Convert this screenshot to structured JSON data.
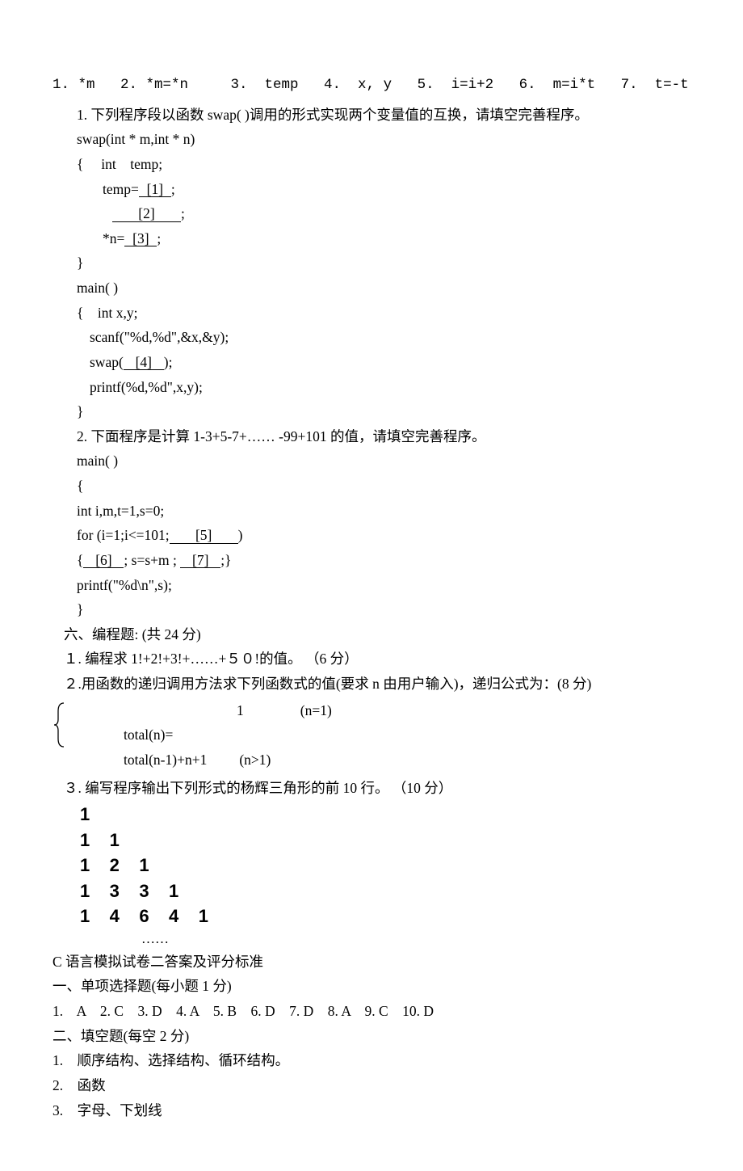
{
  "answers_line": "1. *m   2. *m=*n     3.  temp   4.  x, y   5.  i=i+2   6.  m=i*t   7.  t=-t",
  "q1": {
    "prompt": "1. 下列程序段以函数 swap( )调用的形式实现两个变量值的互换，请填空完善程序。",
    "code": {
      "l1": "swap(int * m,int * n)",
      "l2": "{     int    temp;",
      "l3_a": "  temp=",
      "b1": "[1]",
      "l3_b": ";",
      "b2": "[2]",
      "l4_b": ";",
      "l5_a": "*n=",
      "b3": "[3]",
      "l5_b": ";",
      "l6": "}",
      "l7": "main( )",
      "l8": "{    int x,y;",
      "l9": "scanf(\"%d,%d\",&x,&y);",
      "l10_a": "swap(",
      "b4": "[4]",
      "l10_b": ");",
      "l11": "printf(%d,%d\",x,y);",
      "l12": "}"
    }
  },
  "q2": {
    "prompt": "2. 下面程序是计算 1-3+5-7+……  -99+101 的值，请填空完善程序。",
    "code": {
      "l1": "main( )",
      "l2": "{",
      "l3": "int i,m,t=1,s=0;",
      "l4_a": "for (i=1;i<=101;",
      "b5": "[5]",
      "l4_b": ")",
      "l5_a": "{",
      "b6": "[6]",
      "l5_b": ";    s=s+m ;  ",
      "b7": "[7]",
      "l5_c": ";}",
      "l6": "printf(\"%d\\n\",s);",
      "l7": "}"
    }
  },
  "section6": {
    "heading": "六、编程题: (共 24 分)",
    "p1": "１. 编程求 1!+2!+3!+……+５０!的值。 （6 分）",
    "p2": "２.用函数的递归调用方法求下列函数式的值(要求 n 由用户输入)，递归公式为：(8 分)",
    "formula": {
      "top_left": "",
      "top_mid": "1",
      "top_right": "(n=1)",
      "mid": "total(n)=",
      "bot_left": "total(n-1)+n+1",
      "bot_right": "(n>1)"
    },
    "p3": "３. 编写程序输出下列形式的杨辉三角形的前 10 行。 （10 分）",
    "pascal": {
      "r1": "1",
      "r2": "1    1",
      "r3": "1    2    1",
      "r4": "1    3    3    1",
      "r5": "1    4    6    4    1",
      "dots": "……"
    }
  },
  "answers": {
    "title": "C 语言模拟试卷二答案及评分标准",
    "s1_h": "一、单项选择题(每小题 1 分)",
    "s1_a": "1.    A    2. C    3. D    4. A    5. B    6. D    7. D    8. A    9. C    10. D",
    "s2_h": "二、填空题(每空 2 分)",
    "s2_1": "1.    顺序结构、选择结构、循环结构。",
    "s2_2": "2.    函数",
    "s2_3": "3.    字母、下划线"
  }
}
